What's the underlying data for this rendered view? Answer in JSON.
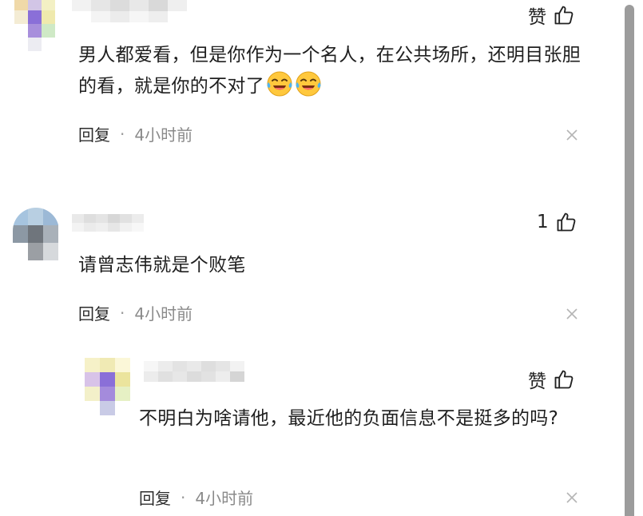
{
  "comments": [
    {
      "like_label": "赞",
      "text": "男人都爱看，但是你作为一个名人，在公共场所，还明目张胆的看，就是你的不对了",
      "emoji": [
        "crying-laughing-icon",
        "crying-laughing-icon"
      ],
      "reply_label": "回复",
      "separator": "·",
      "time": "4小时前"
    },
    {
      "like_label": "1",
      "text": "请曾志伟就是个败笔",
      "reply_label": "回复",
      "separator": "·",
      "time": "4小时前"
    },
    {
      "like_label": "赞",
      "text": "不明白为啥请他，最近他的负面信息不是挺多的吗?",
      "reply_label": "回复",
      "separator": "·",
      "time": "4小时前"
    }
  ],
  "colors": {
    "text": "#1f1f1f",
    "meta": "#8a8a8a",
    "scrollbar": "#9c9c9c"
  }
}
